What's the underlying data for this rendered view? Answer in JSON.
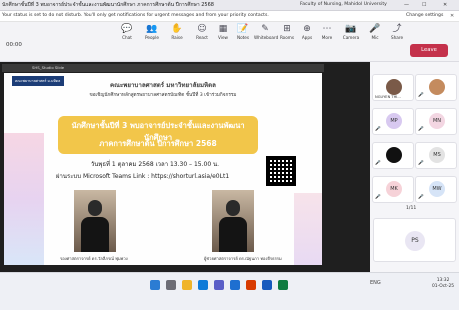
{
  "window": {
    "title": "นักศึกษาชั้นปีที่ 3 พบอาจารย์ประจำชั้นและงานพัฒนานักศึกษา ภาคการศึกษาต้น ปีการศึกษา 2568",
    "org": "Faculty of Nursing, Mahidol University",
    "org_badge": "FS",
    "minimize": "—",
    "maximize": "☐",
    "close": "✕"
  },
  "notification": {
    "message": "Your status is set to do not disturb. You'll only get notifications for urgent messages and from your priority contacts.",
    "change_settings": "Change settings",
    "dismiss": "✕"
  },
  "toolbar": {
    "timer": "00:00",
    "buttons": [
      {
        "icon": "chat-icon",
        "glyph": "💬",
        "label": "Chat"
      },
      {
        "icon": "people-icon",
        "glyph": "👥",
        "label": "People"
      },
      {
        "icon": "raise-hand-icon",
        "glyph": "✋",
        "label": "Raise"
      },
      {
        "icon": "react-icon",
        "glyph": "☺",
        "label": "React"
      },
      {
        "icon": "view-icon",
        "glyph": "▦",
        "label": "View"
      },
      {
        "icon": "notes-icon",
        "glyph": "📝",
        "label": "Notes"
      },
      {
        "icon": "whiteboard-icon",
        "glyph": "✎",
        "label": "Whiteboard"
      },
      {
        "icon": "rooms-icon",
        "glyph": "⊞",
        "label": "Rooms"
      },
      {
        "icon": "apps-icon",
        "glyph": "⊕",
        "label": "Apps"
      },
      {
        "icon": "more-icon",
        "glyph": "⋯",
        "label": "More"
      },
      {
        "icon": "camera-icon",
        "glyph": "📷",
        "label": "Camera"
      },
      {
        "icon": "mic-icon",
        "glyph": "🎤",
        "label": "Mic"
      },
      {
        "icon": "share-icon",
        "glyph": "⤴",
        "label": "Share"
      }
    ],
    "leave_label": "Leave"
  },
  "stage": {
    "subbar_title": "SHS_Studio Slide"
  },
  "slide": {
    "logo_text": "คณะพยาบาลศาสตร์ ม.มหิดล",
    "faculty": "คณะพยาบาลศาสตร์ มหาวิทยาลัยมหิดล",
    "invite": "ขอเชิญนักศึกษาหลักสูตรพยาบาลศาสตรบัณฑิต ชั้นปีที่ 3 เข้าร่วมกิจกรรม",
    "banner_line1": "นักศึกษาชั้นปีที่ 3 พบอาจารย์ประจำชั้นและงานพัฒนานักศึกษา",
    "banner_line2": "ภาคการศึกษาต้น ปีการศึกษา 2568",
    "date": "วันพุธที่ 1 ตุลาคม 2568 เวลา 13.30 – 15.00 น.",
    "via": "ผ่านระบบ Microsoft Teams  Link : https://shorturl.asia/e0Lt1",
    "caption1": "รองศาสตราจารย์ ดร.วัลลีภรณ์ พุ่มพวง",
    "caption2": "ผู้ช่วยศาสตราจารย์ ดร.ณัฐนภา ทองจีรธรรม"
  },
  "participants": [
    {
      "name": "NGUYEN THI...",
      "initials": "",
      "color": "#7a5a48"
    },
    {
      "name": "",
      "initials": "",
      "color": "#c48b5e"
    },
    {
      "name": "",
      "initials": "MP",
      "color": "#d8c9f0"
    },
    {
      "name": "",
      "initials": "MN",
      "color": "#f3d6e2"
    },
    {
      "name": "",
      "initials": "",
      "color": "#111111"
    },
    {
      "name": "",
      "initials": "MS",
      "color": "#e3e3e3"
    },
    {
      "name": "",
      "initials": "MK",
      "color": "#f6d2d8"
    },
    {
      "name": "",
      "initials": "MW",
      "color": "#d6e4f7"
    },
    {
      "name": "",
      "initials": "PS",
      "color": "#e9e6f3"
    }
  ],
  "pager": "1/11",
  "taskbar": {
    "time": "13:32",
    "date": "01-Oct-25",
    "lang": "ENG"
  },
  "colors": {
    "leave": "#c4314b",
    "banner": "#f2c64a",
    "accent": "#5b5fc7"
  }
}
